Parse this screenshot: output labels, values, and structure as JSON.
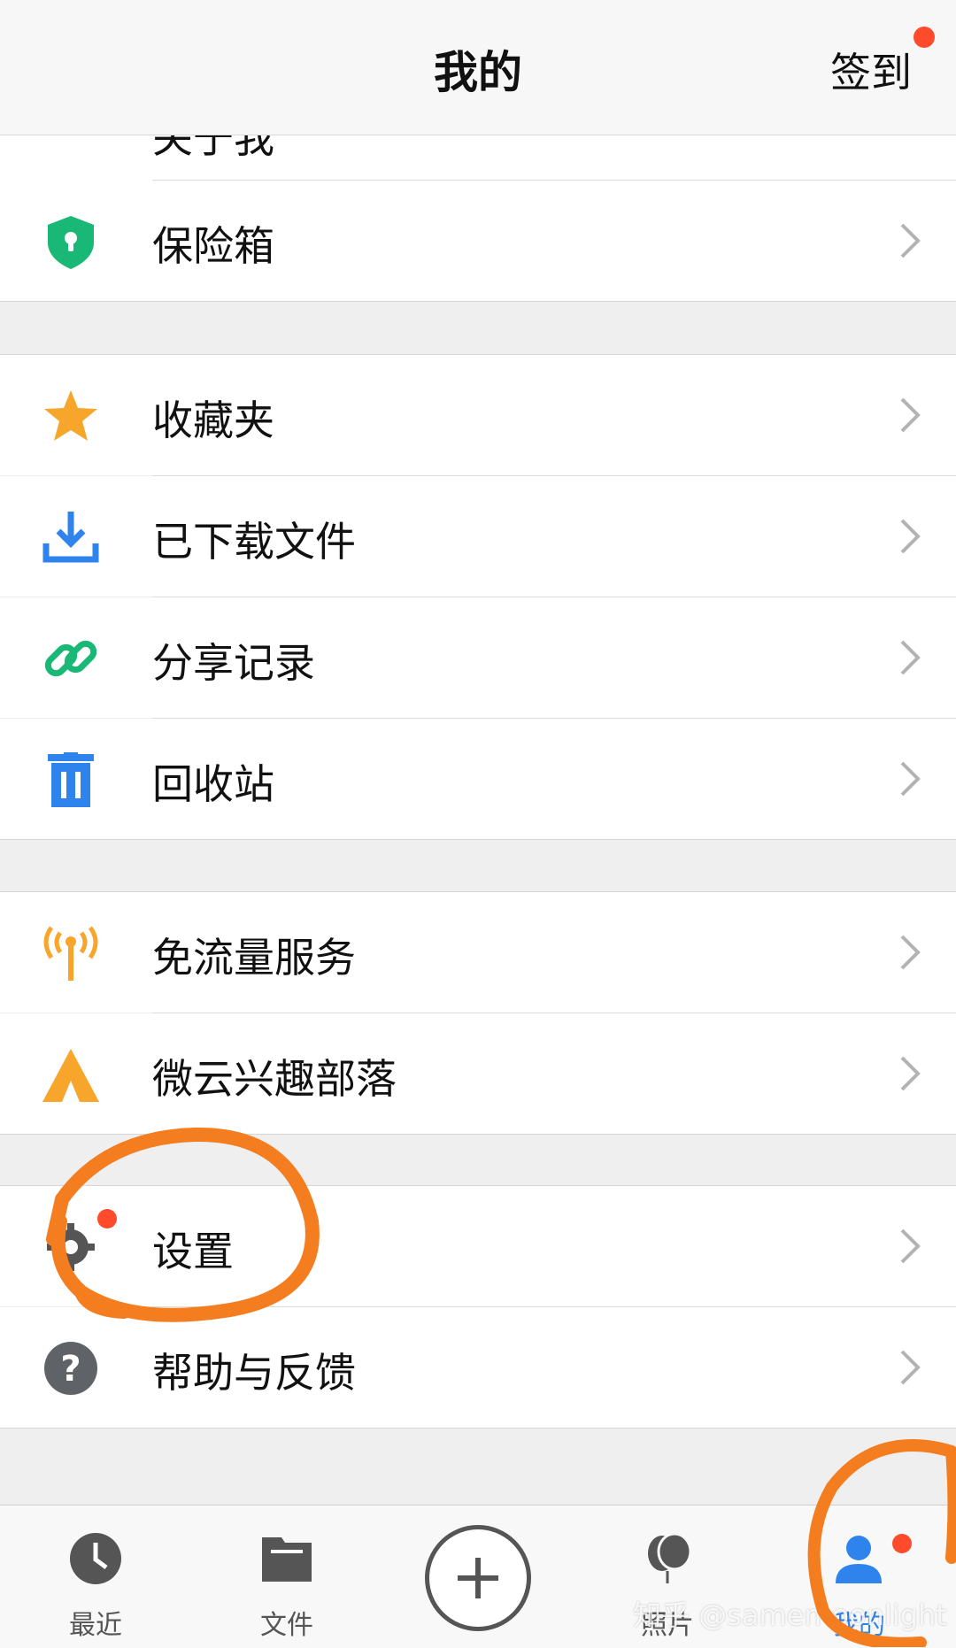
{
  "header": {
    "title": "我的",
    "checkin_label": "签到"
  },
  "top_partial_item": {
    "label": "关于我"
  },
  "menu_groups": [
    {
      "items": [
        {
          "label": "保险箱",
          "icon": "shield-lock-icon"
        }
      ]
    },
    {
      "items": [
        {
          "label": "收藏夹",
          "icon": "star-icon"
        },
        {
          "label": "已下载文件",
          "icon": "download-icon"
        },
        {
          "label": "分享记录",
          "icon": "link-icon"
        },
        {
          "label": "回收站",
          "icon": "trash-icon"
        }
      ]
    },
    {
      "items": [
        {
          "label": "免流量服务",
          "icon": "antenna-icon"
        },
        {
          "label": "微云兴趣部落",
          "icon": "tent-icon"
        }
      ]
    },
    {
      "items": [
        {
          "label": "设置",
          "icon": "gear-icon"
        },
        {
          "label": "帮助与反馈",
          "icon": "help-icon"
        }
      ]
    }
  ],
  "tabbar": {
    "tabs": [
      {
        "label": "最近",
        "icon": "clock-icon"
      },
      {
        "label": "文件",
        "icon": "folder-icon"
      },
      {
        "label": "",
        "icon": "plus-icon"
      },
      {
        "label": "照片",
        "icon": "balloon-icon"
      },
      {
        "label": "我的",
        "icon": "user-icon",
        "active": true
      }
    ]
  },
  "watermark": "知乎 @samemoonlight",
  "colors": {
    "accent": "#2f83ec",
    "badge": "#ff4b2b",
    "annotation": "#f47d20",
    "green": "#19b877",
    "orange": "#f7a52b"
  }
}
